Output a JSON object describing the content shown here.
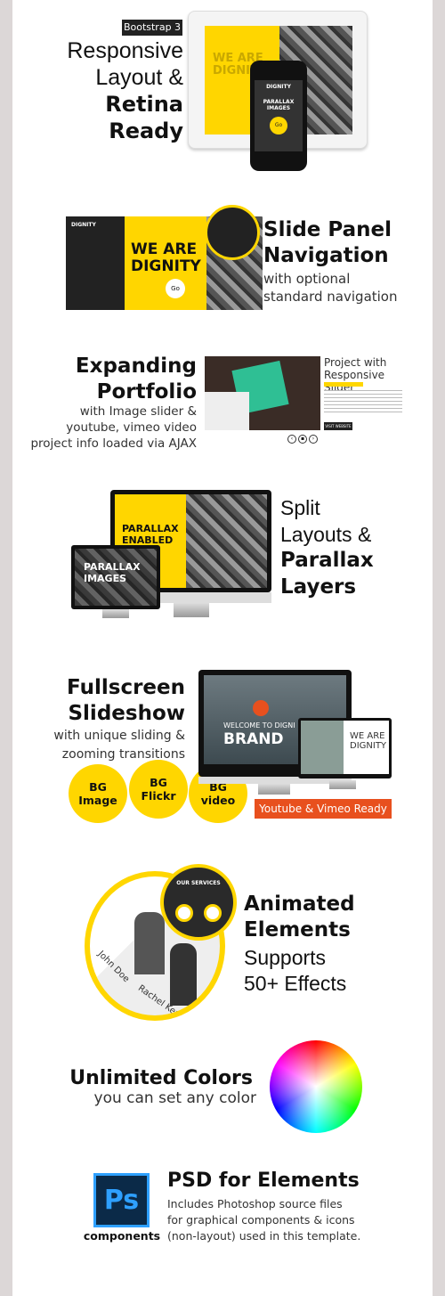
{
  "colors": {
    "accent": "#ffd600",
    "orange": "#e8501e",
    "dark": "#222222",
    "psd_blue": "#2ea0ff",
    "psd_bg": "#0b2a48"
  },
  "section1": {
    "badge": "Bootstrap 3",
    "line1": "Responsive",
    "line2": "Layout &",
    "line3": "Retina",
    "line4": "Ready",
    "mock": {
      "tablet_headline1": "WE ARE",
      "tablet_headline2": "DIGNITY",
      "phone_brand": "DIGNITY",
      "phone_headline1": "PARALLAX",
      "phone_headline2": "IMAGES",
      "button": "Go"
    }
  },
  "section2": {
    "title1": "Slide Panel",
    "title2": "Navigation",
    "sub1": "with optional",
    "sub2": "standard navigation",
    "mock": {
      "brand": "DIGNITY",
      "headline1": "WE ARE",
      "headline2": "DIGNITY",
      "button": "Go"
    }
  },
  "section3": {
    "title1": "Expanding",
    "title2": "Portfolio",
    "sub1": "with Image slider &",
    "sub2": "youtube, vimeo video",
    "sub3": "project info loaded via AJAX",
    "mock": {
      "project_title": "Project with Responsive Slider",
      "visit": "VISIT WEBSITE"
    }
  },
  "section4": {
    "line1": "Split",
    "line2": "Layouts &",
    "line3": "Parallax",
    "line4": "Layers",
    "mock": {
      "big_headline1": "PARALLAX",
      "big_headline2": "ENABLED",
      "small_headline1": "PARALLAX",
      "small_headline2": "IMAGES"
    }
  },
  "section5": {
    "title1": "Fullscreen",
    "title2": "Slideshow",
    "sub1": "with unique sliding &",
    "sub2": "zooming transitions",
    "badges": [
      {
        "l1": "BG",
        "l2": "Image"
      },
      {
        "l1": "BG",
        "l2": "Flickr"
      },
      {
        "l1": "BG",
        "l2": "video"
      }
    ],
    "ready": "Youtube & Vimeo Ready",
    "mock": {
      "welcome": "WELCOME TO DIGNI",
      "brand": "BRAND",
      "small1": "WE ARE",
      "small2": "DIGNITY"
    }
  },
  "section6": {
    "title1": "Animated",
    "title2": "Elements",
    "sub1": "Supports",
    "sub2": "50+ Effects",
    "mock": {
      "services": "OUR SERVICES",
      "person1": "John Doe",
      "person2": "Rachel Ken"
    }
  },
  "section7": {
    "title": "Unlimited Colors",
    "sub": "you can set any color"
  },
  "section8": {
    "icon_text": "Ps",
    "caption": "components",
    "title": "PSD for Elements",
    "sub1": "Includes Photoshop source files",
    "sub2": "for graphical components & icons",
    "sub3": "(non-layout) used in this template."
  }
}
